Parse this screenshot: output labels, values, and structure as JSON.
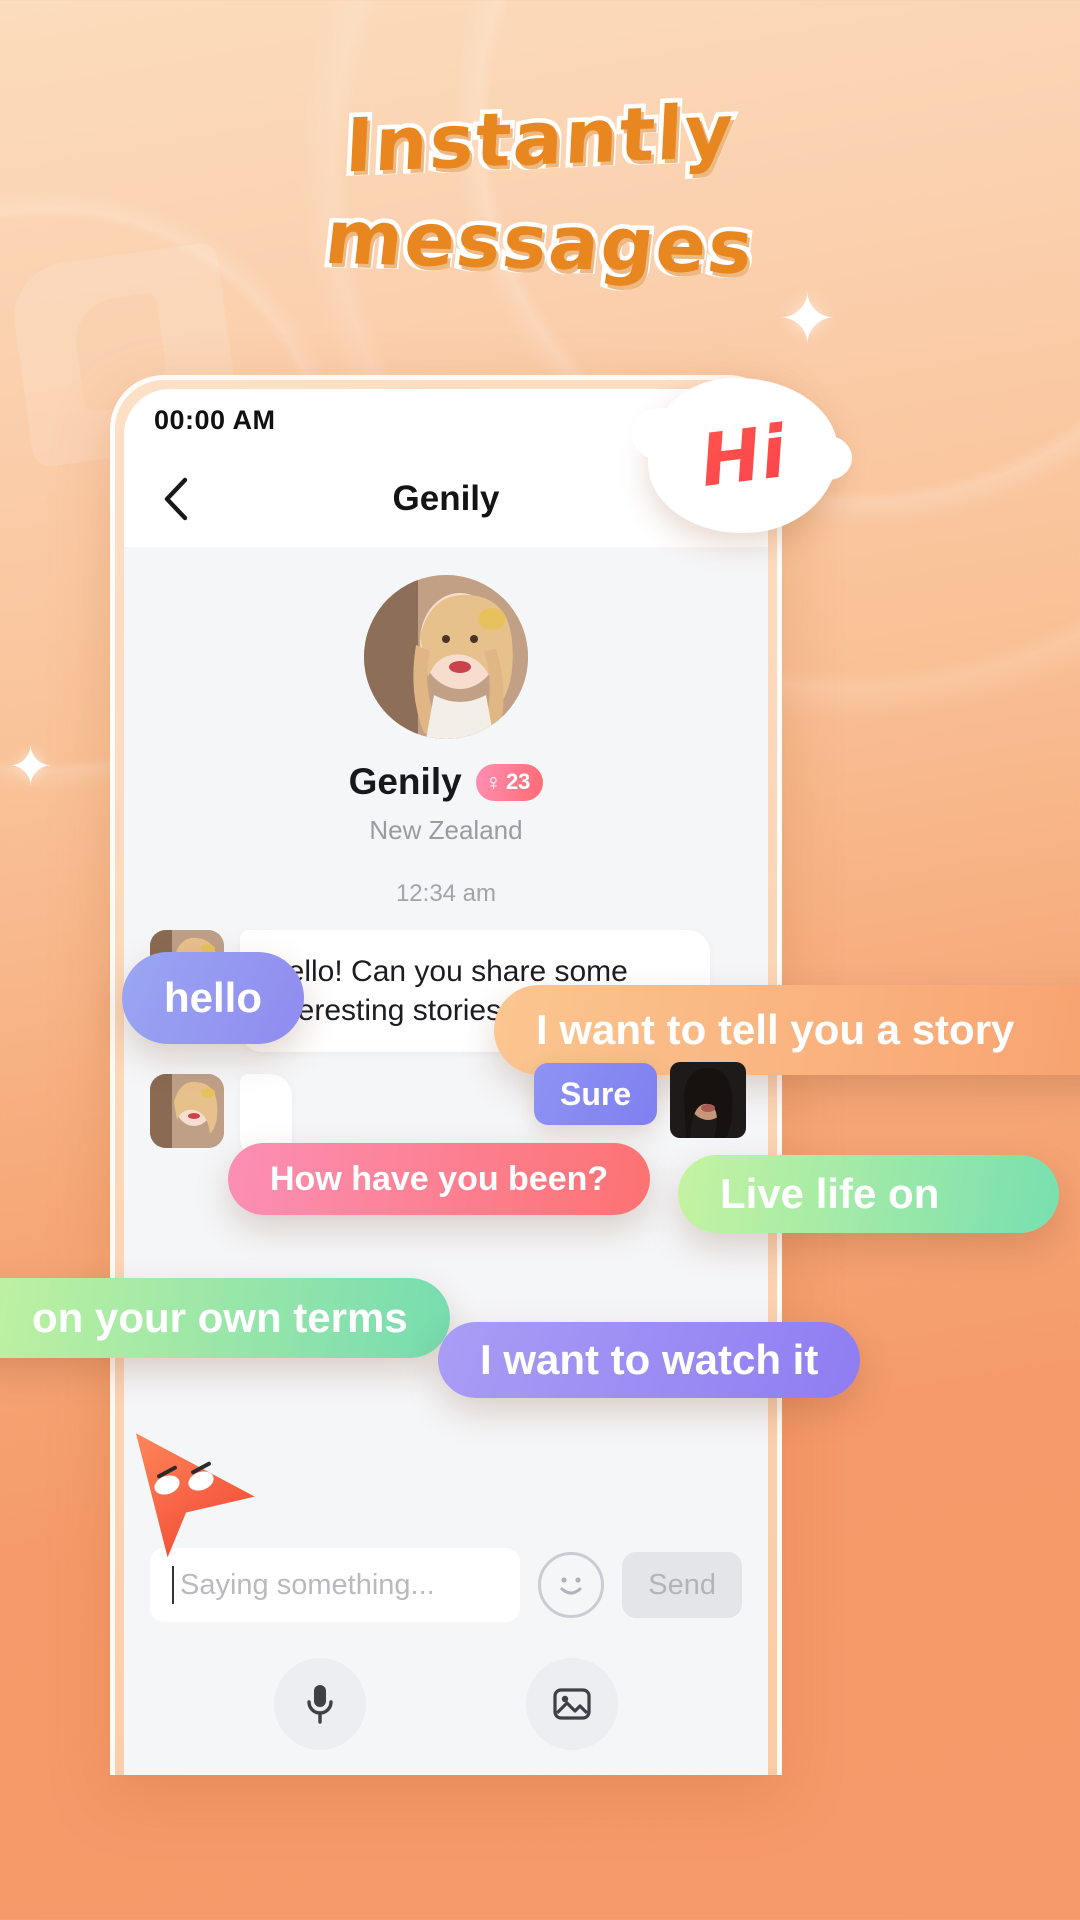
{
  "headline": {
    "line1": "Instantly",
    "line2": "messages",
    "color": "#e8861f"
  },
  "sticker": {
    "hi_label": "Hi"
  },
  "phone": {
    "statusbar": {
      "time": "00:00 AM",
      "wifi_icon": "wifi-icon",
      "signal_icon": "signal-icon"
    },
    "navbar": {
      "back_icon": "chevron-left-icon",
      "title": "Genily"
    },
    "profile": {
      "avatar": "user-avatar",
      "name": "Genily",
      "gender_icon": "female-icon",
      "age": "23",
      "location": "New Zealand",
      "badge_color": "#ff7a86"
    },
    "conversation": {
      "timestamp": "12:34 am",
      "messages": [
        {
          "side": "in",
          "text": "Hello! Can you share some interesting stories ?",
          "avatar": "genily-avatar"
        },
        {
          "side": "in",
          "text": "",
          "avatar": "genily-avatar"
        }
      ]
    },
    "composer": {
      "placeholder": "Saying something...",
      "value": "",
      "emoji_icon": "smiley-icon",
      "send_label": "Send"
    },
    "bottom_bar": {
      "mic_icon": "microphone-icon",
      "gallery_icon": "image-icon"
    }
  },
  "floating_bubbles": [
    {
      "id": "hello",
      "text": "hello",
      "color": "#8f8bf0"
    },
    {
      "id": "tell",
      "text": "I want to tell you a story",
      "color": "#f89f6d"
    },
    {
      "id": "sure",
      "text": "Sure",
      "color": "#7f7ff0"
    },
    {
      "id": "how",
      "text": "How have you been?",
      "color": "#fd7272"
    },
    {
      "id": "live",
      "text": "Live life on",
      "color": "#78dfb0"
    },
    {
      "id": "terms",
      "text": "on your own terms",
      "color": "#76dcb0"
    },
    {
      "id": "watch",
      "text": "I want to watch it",
      "color": "#8f7df2"
    }
  ],
  "decor": {
    "sparkle_glyph": "✦",
    "cursor": "pointer-arrow"
  }
}
